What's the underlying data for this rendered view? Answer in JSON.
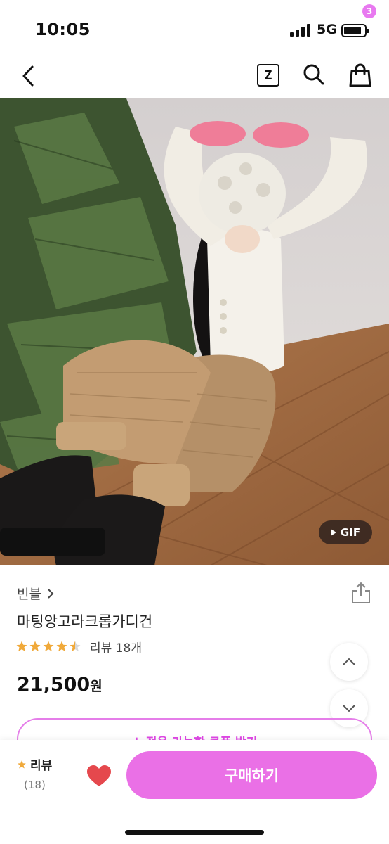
{
  "status_bar": {
    "time": "10:05",
    "network": "5G"
  },
  "nav": {
    "z_label": "Z",
    "cart_count": "3"
  },
  "image": {
    "gif_label": "GIF"
  },
  "product": {
    "brand": "빈블",
    "name": "마팅앙고라크롭가디건",
    "rating": 4.5,
    "review_link": "리뷰 18개",
    "price_number": "21,500",
    "price_unit": "원",
    "coupon_label": "↓ 적용 가능한 쿠폰 받기"
  },
  "bottom_bar": {
    "review_label": "리뷰",
    "review_count": "(18)",
    "buy_label": "구매하기"
  },
  "colors": {
    "accent": "#ea70e6",
    "star": "#f0a93a",
    "heart": "#e5484d"
  }
}
